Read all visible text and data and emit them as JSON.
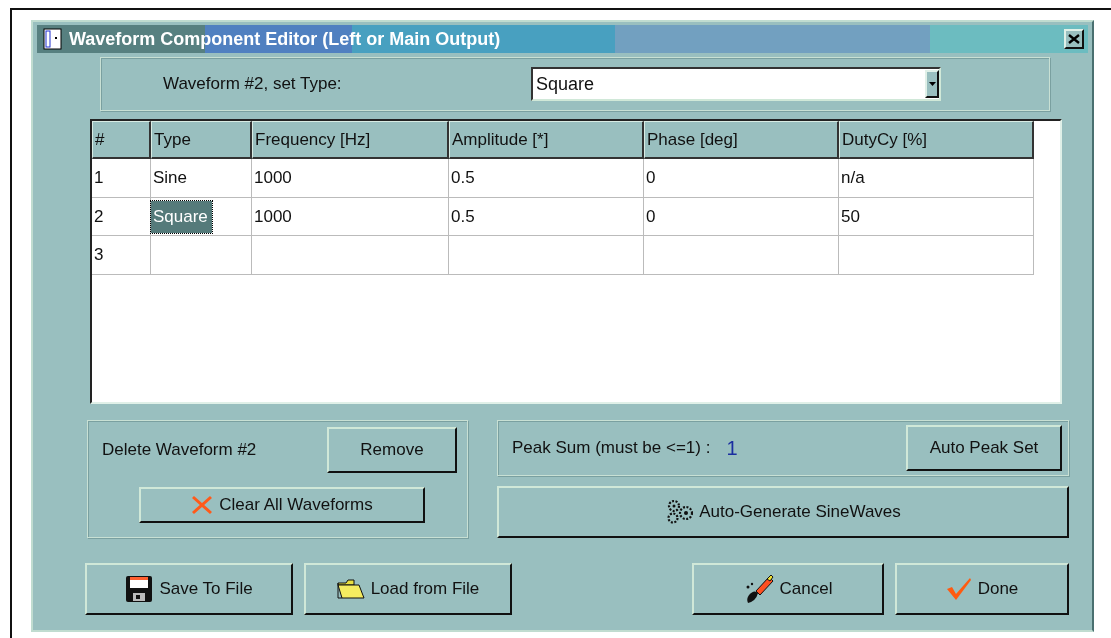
{
  "window": {
    "title": "Waveform Component Editor (Left or Main Output)"
  },
  "type_selector": {
    "label": "Waveform #2, set Type:",
    "value": "Square"
  },
  "table": {
    "columns": [
      "#",
      "Type",
      "Frequency [Hz]",
      "Amplitude [*]",
      "Phase [deg]",
      "DutyCy [%]"
    ],
    "rows": [
      {
        "cells": [
          {
            "text": "1",
            "selected": false
          },
          {
            "text": "Sine",
            "selected": false
          },
          {
            "text": "1000",
            "selected": false
          },
          {
            "text": "0.5",
            "selected": false
          },
          {
            "text": "0",
            "selected": false
          },
          {
            "text": "n/a",
            "selected": false
          }
        ]
      },
      {
        "cells": [
          {
            "text": "2",
            "selected": false
          },
          {
            "text": "Square",
            "selected": true
          },
          {
            "text": "1000",
            "selected": false
          },
          {
            "text": "0.5",
            "selected": false
          },
          {
            "text": "0",
            "selected": false
          },
          {
            "text": "50",
            "selected": false
          }
        ]
      },
      {
        "cells": [
          {
            "text": "3",
            "selected": false
          }
        ]
      }
    ]
  },
  "delete_panel": {
    "label": "Delete Waveform #2",
    "remove_button": "Remove",
    "clear_button": "Clear All Waveforms"
  },
  "peak_panel": {
    "label": "Peak Sum (must be <=1) :",
    "value": "1",
    "button": "Auto Peak Set"
  },
  "generate_button": "Auto-Generate SineWaves",
  "buttons": [
    {
      "label": "Save To File",
      "kind": "save"
    },
    {
      "label": "Load from File",
      "kind": "load"
    },
    {
      "label": "Cancel",
      "kind": "cancel"
    },
    {
      "label": "Done",
      "kind": "done"
    }
  ]
}
